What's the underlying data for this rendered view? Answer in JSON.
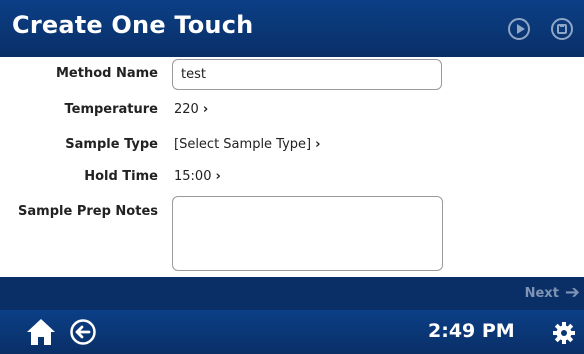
{
  "header": {
    "title": "Create One Touch",
    "play_icon": "play-circle-icon",
    "save_icon": "save-disk-icon"
  },
  "form": {
    "method_name": {
      "label": "Method Name",
      "value": "test"
    },
    "temperature": {
      "label": "Temperature",
      "value": "220"
    },
    "sample_type": {
      "label": "Sample Type",
      "value": "[Select Sample Type]"
    },
    "hold_time": {
      "label": "Hold Time",
      "value": "15:00"
    },
    "sample_prep_notes": {
      "label": "Sample Prep Notes",
      "value": ""
    }
  },
  "chevron": "›",
  "footer": {
    "next_label": "Next",
    "time": "2:49 PM"
  },
  "colors": {
    "header_bg": "#0a2f67",
    "disabled_text": "#7f93b5"
  }
}
